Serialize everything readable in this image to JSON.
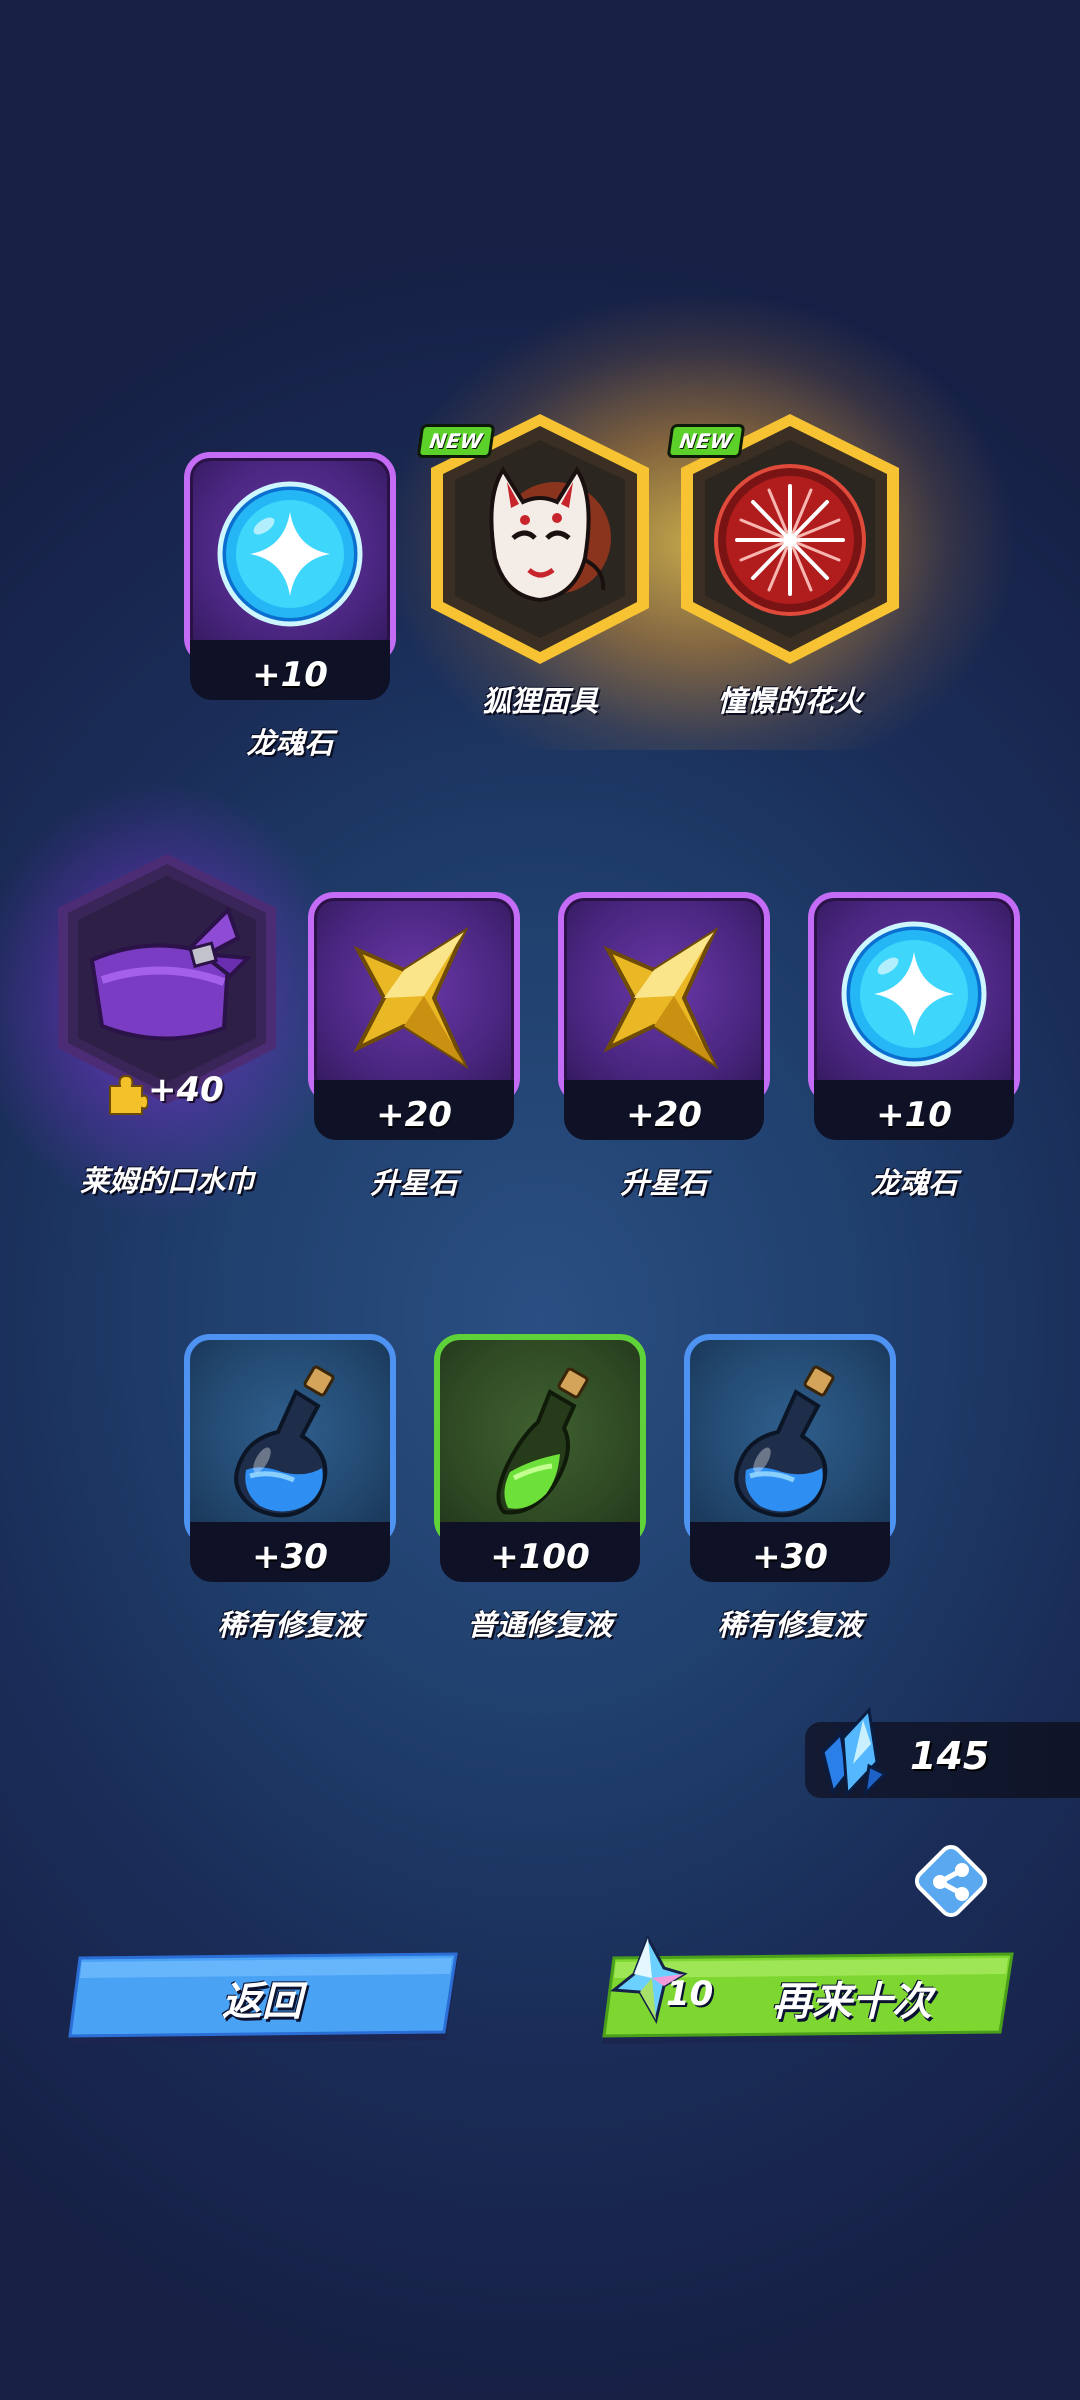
{
  "colors": {
    "purple_frame": "#c46cf5",
    "blue_frame": "#4f93f2",
    "green_frame": "#5fd23a",
    "gold_frame": "#f2b52a",
    "back_button": "#4aa2f5",
    "again_button": "#7ed630",
    "new_badge": "#5bd12a"
  },
  "row1": [
    {
      "name": "龙魂石",
      "count": "+10",
      "icon": "dragon-soul-stone-icon",
      "rarity": "purple"
    },
    {
      "name": "狐狸面具",
      "badge": "NEW",
      "icon": "fox-mask-icon",
      "rarity": "gold"
    },
    {
      "name": "憧憬的花火",
      "badge": "NEW",
      "icon": "firework-icon",
      "rarity": "gold"
    }
  ],
  "row2": [
    {
      "name": "莱姆的口水巾",
      "count": "+40",
      "icon": "bandana-icon",
      "rarity": "purple-hex",
      "fragment_icon": "puzzle-piece-icon"
    },
    {
      "name": "升星石",
      "count": "+20",
      "icon": "star-stone-icon",
      "rarity": "purple"
    },
    {
      "name": "升星石",
      "count": "+20",
      "icon": "star-stone-icon",
      "rarity": "purple"
    },
    {
      "name": "龙魂石",
      "count": "+10",
      "icon": "dragon-soul-stone-icon",
      "rarity": "purple"
    }
  ],
  "row3": [
    {
      "name": "稀有修复液",
      "count": "+30",
      "icon": "blue-potion-icon",
      "rarity": "blue"
    },
    {
      "name": "普通修复液",
      "count": "+100",
      "icon": "green-potion-icon",
      "rarity": "green"
    },
    {
      "name": "稀有修复液",
      "count": "+30",
      "icon": "blue-potion-icon",
      "rarity": "blue"
    }
  ],
  "currency": {
    "icon": "crystal-icon",
    "value": "145"
  },
  "share": {
    "icon": "share-icon"
  },
  "buttons": {
    "back_label": "返回",
    "again_label": "再来十次",
    "again_cost": "10",
    "again_cost_icon": "crystal-icon"
  }
}
